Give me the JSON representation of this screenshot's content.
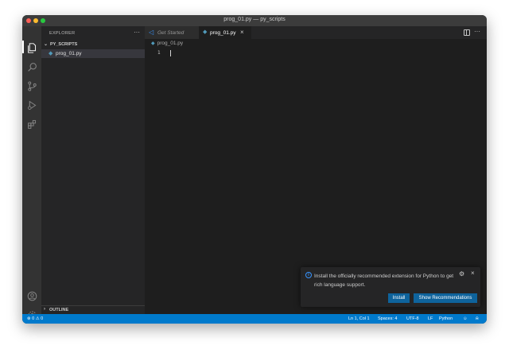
{
  "window": {
    "title": "prog_01.py — py_scripts"
  },
  "activity_bar": {
    "items": [
      "explorer-icon",
      "search-icon",
      "source-control-icon",
      "run-debug-icon",
      "extensions-icon"
    ],
    "bottom": [
      "account-icon",
      "manage-gear-icon"
    ]
  },
  "sidebar": {
    "header": "EXPLORER",
    "more": "···",
    "folder": "PY_SCRIPTS",
    "files": [
      {
        "name": "prog_01.py"
      }
    ],
    "outline": "OUTLINE"
  },
  "tabs": [
    {
      "label": "Get Started",
      "icon": "vscode-icon"
    },
    {
      "label": "prog_01.py",
      "icon": "python-icon",
      "close": "×"
    }
  ],
  "editor": {
    "breadcrumb": "prog_01.py",
    "lines": [
      "1"
    ]
  },
  "notification": {
    "text": "Install the officially recommended extension for Python to get rich language support.",
    "install_label": "Install",
    "recommendations_label": "Show Recommendations",
    "close": "×"
  },
  "statusbar": {
    "problems": "⊗ 0 ⚠ 0",
    "position": "Ln 1, Col 1",
    "spaces": "Spaces: 4",
    "encoding": "UTF-8",
    "eol": "LF",
    "language": "Python"
  },
  "colors": {
    "accent": "#007acc",
    "button": "#0e639c",
    "python": "#519aba"
  }
}
